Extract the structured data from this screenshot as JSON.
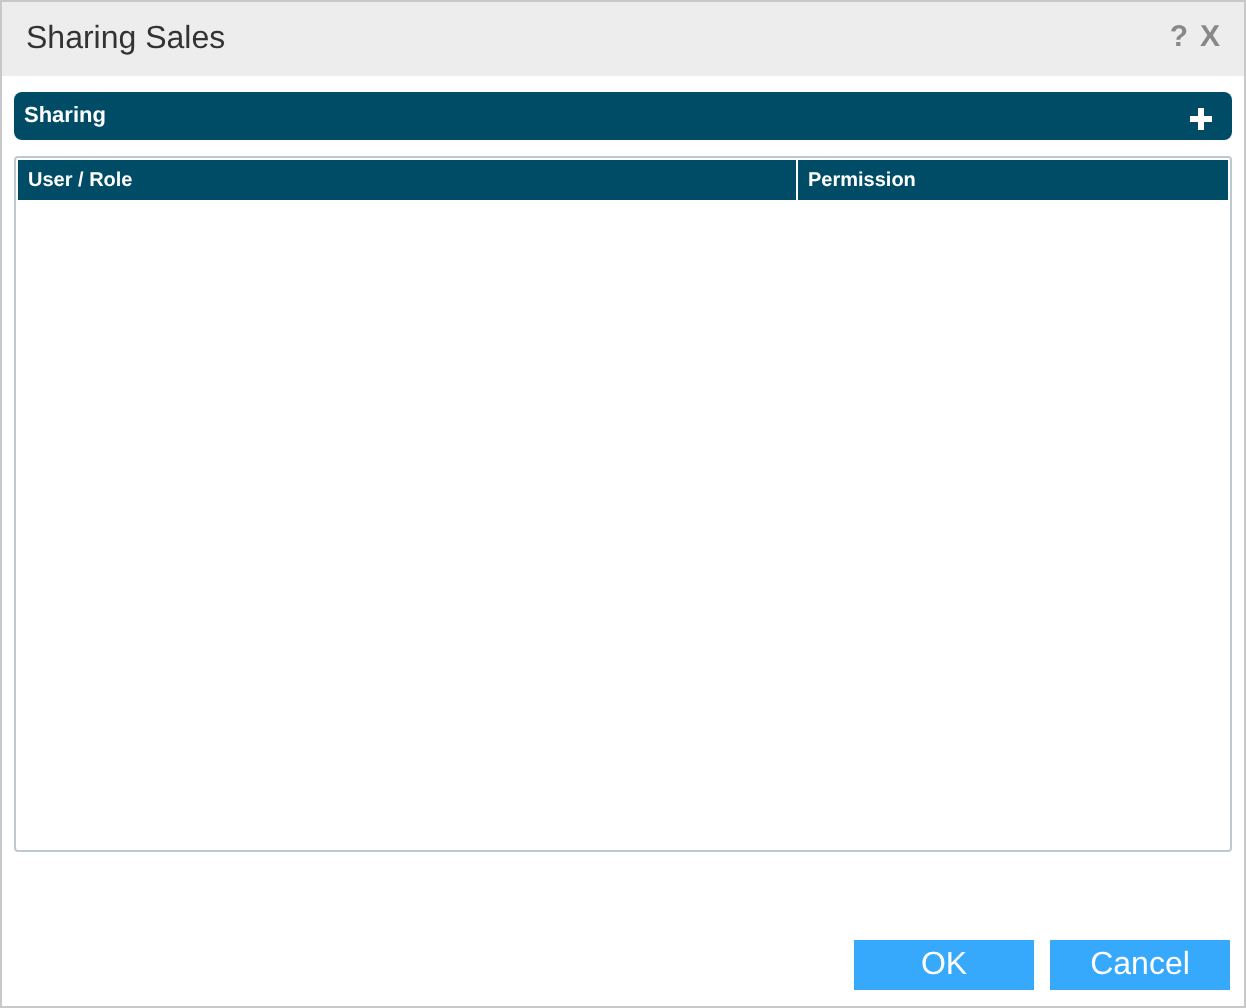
{
  "window": {
    "title": "Sharing Sales",
    "help": "?",
    "close": "X"
  },
  "panel": {
    "title": "Sharing"
  },
  "table": {
    "columns": [
      "User / Role",
      "Permission"
    ]
  },
  "buttons": [
    "OK",
    "Cancel"
  ]
}
